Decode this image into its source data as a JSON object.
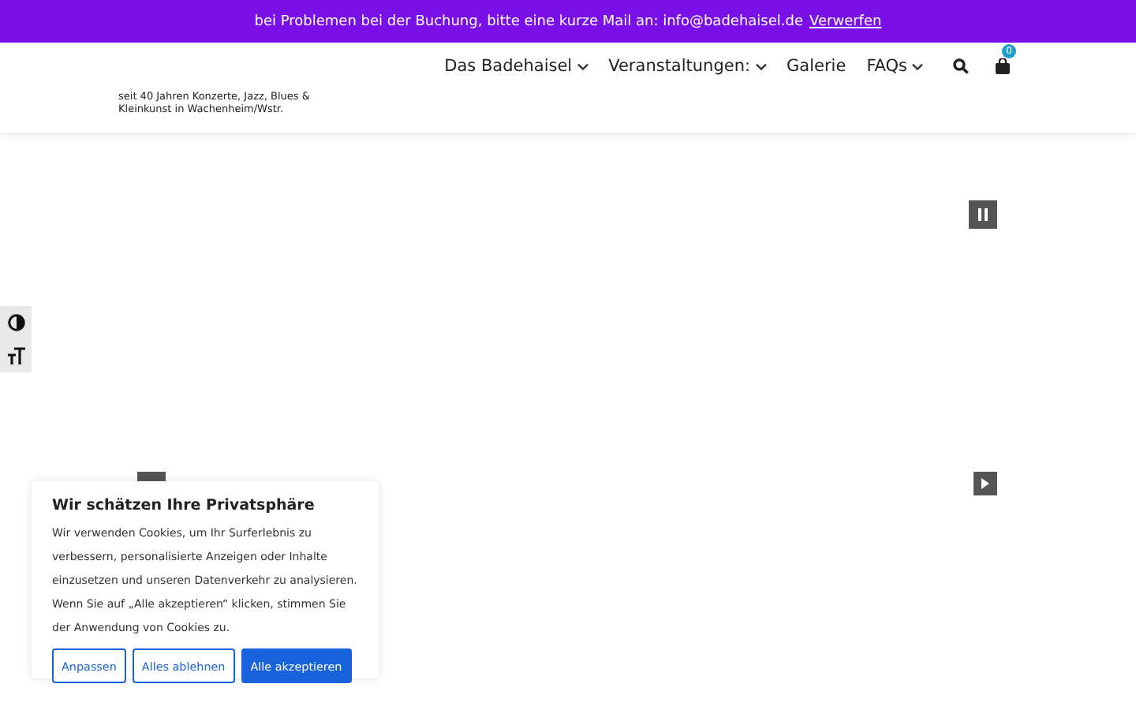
{
  "notice_bar": {
    "text": "bei Problemen bei der Buchung, bitte eine kurze Mail an: info@badehaisel.de",
    "dismiss_link": "Verwerfen"
  },
  "header": {
    "tagline": "seit 40 Jahren Konzerte, Jazz, Blues & Kleinkunst in Wachenheim/Wstr.",
    "nav": [
      {
        "label": "Das Badehaisel",
        "has_submenu": true
      },
      {
        "label": "Veranstaltungen:",
        "has_submenu": true
      },
      {
        "label": "Galerie",
        "has_submenu": false
      },
      {
        "label": "FAQs",
        "has_submenu": true
      }
    ],
    "cart_count": "0"
  },
  "slider": {
    "playing": true
  },
  "cookie_dialog": {
    "title": "Wir schätzen Ihre Privatsphäre",
    "text": "Wir verwenden Cookies, um Ihr Surferlebnis zu verbessern, personalisierte Anzeigen oder Inhalte einzusetzen und unseren Datenverkehr zu analysieren. Wenn Sie auf „Alle akzeptieren“ klicken, stimmen Sie der Anwendung von Cookies zu.",
    "buttons": [
      {
        "label": "Anpassen",
        "kind": "outline"
      },
      {
        "label": "Alles ablehnen",
        "kind": "outline"
      },
      {
        "label": "Alle akzeptieren",
        "kind": "primary"
      }
    ]
  }
}
